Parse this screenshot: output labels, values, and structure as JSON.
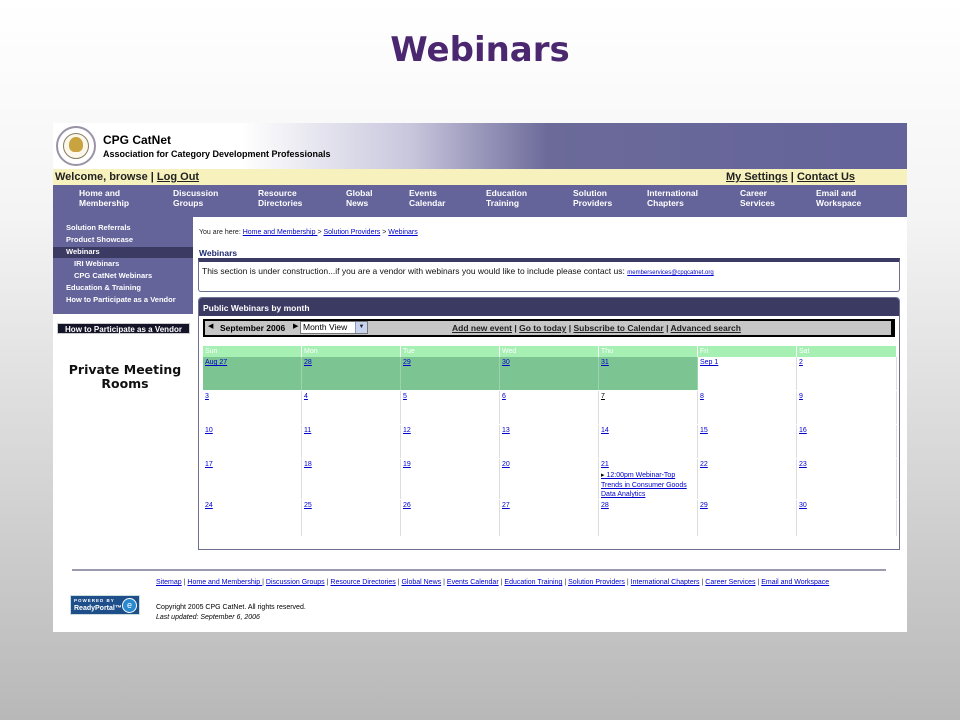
{
  "slide": {
    "title": "Webinars"
  },
  "brand": {
    "name": "CPG CatNet",
    "tagline": "Association for Category Development Professionals"
  },
  "welcome": {
    "prefix": "Welcome, browse |",
    "logout": "Log Out",
    "settings": "My Settings",
    "separator": "|",
    "contact": "Contact Us"
  },
  "nav": [
    {
      "label": "Home and\nMembership"
    },
    {
      "label": "Discussion\nGroups"
    },
    {
      "label": "Resource\nDirectories"
    },
    {
      "label": "Global\nNews"
    },
    {
      "label": "Events\nCalendar"
    },
    {
      "label": "Education\nTraining"
    },
    {
      "label": "Solution\nProviders"
    },
    {
      "label": "International\nChapters"
    },
    {
      "label": "Career\nServices"
    },
    {
      "label": "Email and\nWorkspace"
    }
  ],
  "sidebar": {
    "items": [
      {
        "label": "Solution Referrals"
      },
      {
        "label": "Product Showcase"
      },
      {
        "label": "Webinars"
      },
      {
        "label": "IRI Webinars"
      },
      {
        "label": "CPG CatNet Webinars"
      },
      {
        "label": "Education & Training"
      },
      {
        "label": "How to Participate as a Vendor"
      }
    ],
    "participate_button": "How to Participate as a Vendor",
    "private_meeting": "Private Meeting Rooms"
  },
  "breadcrumb": {
    "prefix": "You are here:",
    "home": "Home and Membership ",
    "sep1": ">",
    "providers": "Solution Providers",
    "sep2": ">",
    "current": "Webinars "
  },
  "section_title": "Webinars",
  "notice": {
    "text": "This section is under construction...if you are a vendor with webinars you would like to include please contact us:",
    "email": "memberservices@cpgcatnet.org"
  },
  "calendar": {
    "header": "Public Webinars by month",
    "month": "September 2006",
    "view": "Month View",
    "links": {
      "add": "Add new event",
      "sep1": "|",
      "goto": "Go to today",
      "sep2": "|",
      "subscribe": "Subscribe to Calendar",
      "sep3": "|",
      "search": "Advanced search"
    },
    "day_headers": [
      "Sun",
      "Mon",
      "Tue",
      "Wed",
      "Thu",
      "Fri",
      "Sat"
    ],
    "weeks": [
      [
        "Aug 27",
        "28",
        "29",
        "30",
        "31",
        "Sep 1",
        "2"
      ],
      [
        "3",
        "4",
        "5",
        "6",
        "7",
        "8",
        "9"
      ],
      [
        "10",
        "11",
        "12",
        "13",
        "14",
        "15",
        "16"
      ],
      [
        "17",
        "18",
        "19",
        "20",
        "21",
        "22",
        "23"
      ],
      [
        "24",
        "25",
        "26",
        "27",
        "28",
        "29",
        "30"
      ]
    ],
    "event": {
      "text": "12:00pm Webinar-Top Trends in Consumer Goods Data Analytics"
    }
  },
  "footer": {
    "links": [
      "Sitemap",
      "Home and Membership ",
      "Discussion Groups",
      "Resource Directories",
      "Global News",
      "Events Calendar",
      "Education Training",
      "Solution Providers",
      "International Chapters",
      "Career Services",
      "Email and Workspace"
    ],
    "separator": "|",
    "copyright": "Copyright 2005 CPG CatNet. All rights reserved.",
    "updated": "Last updated: September 6, 2006",
    "powered_top": "POWERED BY",
    "powered_name": "ReadyPortal™",
    "powered_logo": "e"
  },
  "colors": {
    "nav": "#64639a",
    "nav_dark": "#3b3a63",
    "welcome_bar": "#f7f2bd",
    "calendar_prev": "#7cc492",
    "calendar_header": "#a6f0b4",
    "title": "#4b2770"
  }
}
